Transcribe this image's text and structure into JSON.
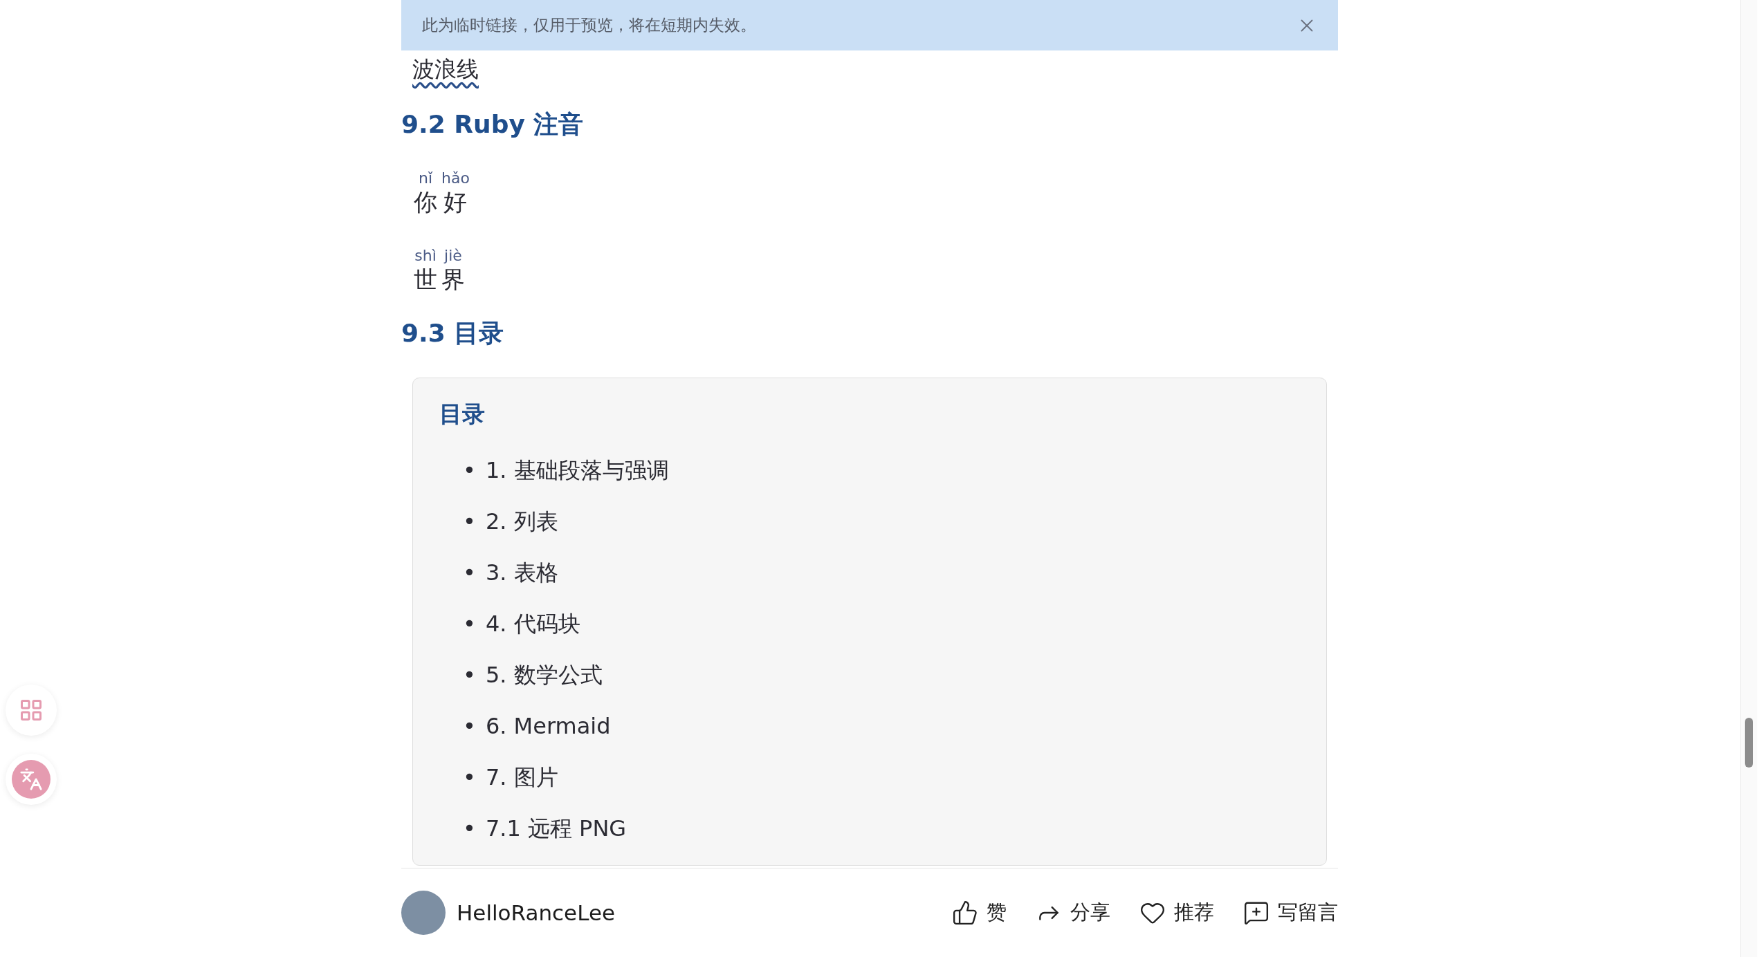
{
  "banner": {
    "text": "此为临时链接，仅用于预览，将在短期内失效。"
  },
  "wavy_text": "波浪线",
  "sections": [
    {
      "kind": "ruby",
      "heading": "9.2 Ruby 注音",
      "ruby": [
        {
          "pairs": [
            {
              "base": "你",
              "reading": "nǐ"
            },
            {
              "base": "好",
              "reading": "hǎo"
            }
          ]
        },
        {
          "pairs": [
            {
              "base": "世",
              "reading": "shì"
            },
            {
              "base": "界",
              "reading": "jiè"
            }
          ]
        }
      ]
    },
    {
      "kind": "toc",
      "heading": "9.3 目录",
      "toc": {
        "title": "目录",
        "marker": "•",
        "items": [
          "1. 基础段落与强调",
          "2. 列表",
          "3. 表格",
          "4. 代码块",
          "5. 数学公式",
          "6. Mermaid",
          "7. 图片",
          "7.1 远程 PNG"
        ]
      }
    }
  ],
  "footer": {
    "author": "HelloRanceLee",
    "actions": [
      {
        "kind": "like",
        "label": "赞"
      },
      {
        "kind": "share",
        "label": "分享"
      },
      {
        "kind": "recommend",
        "label": "推荐"
      },
      {
        "kind": "comment",
        "label": "写留言"
      }
    ]
  }
}
